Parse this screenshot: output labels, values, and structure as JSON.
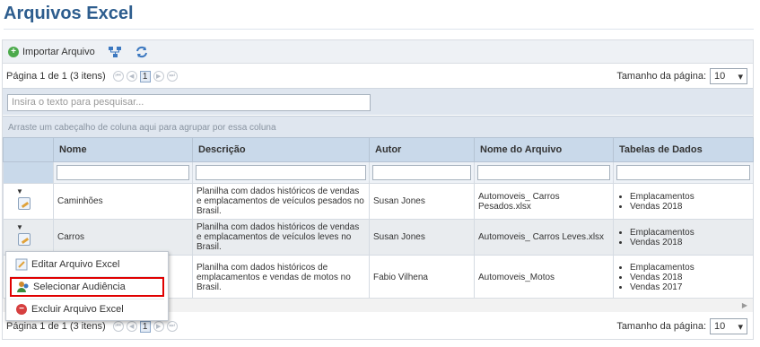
{
  "page": {
    "title": "Arquivos Excel"
  },
  "toolbar": {
    "import_label": "Importar Arquivo"
  },
  "pager": {
    "info": "Página 1 de 1 (3 itens)",
    "current_page": "1",
    "size_label": "Tamanho da página:",
    "size_value": "10"
  },
  "search": {
    "placeholder": "Insira o texto para pesquisar..."
  },
  "group_hint": "Arraste um cabeçalho de coluna aqui para agrupar por essa coluna",
  "columns": [
    "Nome",
    "Descrição",
    "Autor",
    "Nome do Arquivo",
    "Tabelas de Dados"
  ],
  "rows": [
    {
      "nome": "Caminhões",
      "descricao": "Planilha com dados históricos de vendas e emplacamentos de veículos pesados no Brasil.",
      "autor": "Susan Jones",
      "arquivo": "Automoveis_ Carros Pesados.xlsx",
      "tabelas": [
        "Emplacamentos",
        "Vendas 2018"
      ]
    },
    {
      "nome": "Carros",
      "descricao": "Planilha com dados históricos de vendas e emplacamentos de veículos leves no Brasil.",
      "autor": "Susan Jones",
      "arquivo": "Automoveis_ Carros Leves.xlsx",
      "tabelas": [
        "Emplacamentos",
        "Vendas 2018"
      ]
    },
    {
      "nome": "",
      "descricao": "Planilha com dados históricos de emplacamentos e vendas de motos no Brasil.",
      "autor": "Fabio Vilhena",
      "arquivo": "Automoveis_Motos",
      "tabelas": [
        "Emplacamentos",
        "Vendas 2018",
        "Vendas 2017"
      ]
    }
  ],
  "context_menu": {
    "edit": "Editar Arquivo Excel",
    "audience": "Selecionar Audiência",
    "delete": "Excluir Arquivo Excel"
  },
  "colors": {
    "title": "#2d5d8e",
    "header": "#c9d9ea",
    "highlight": "#e00000"
  }
}
